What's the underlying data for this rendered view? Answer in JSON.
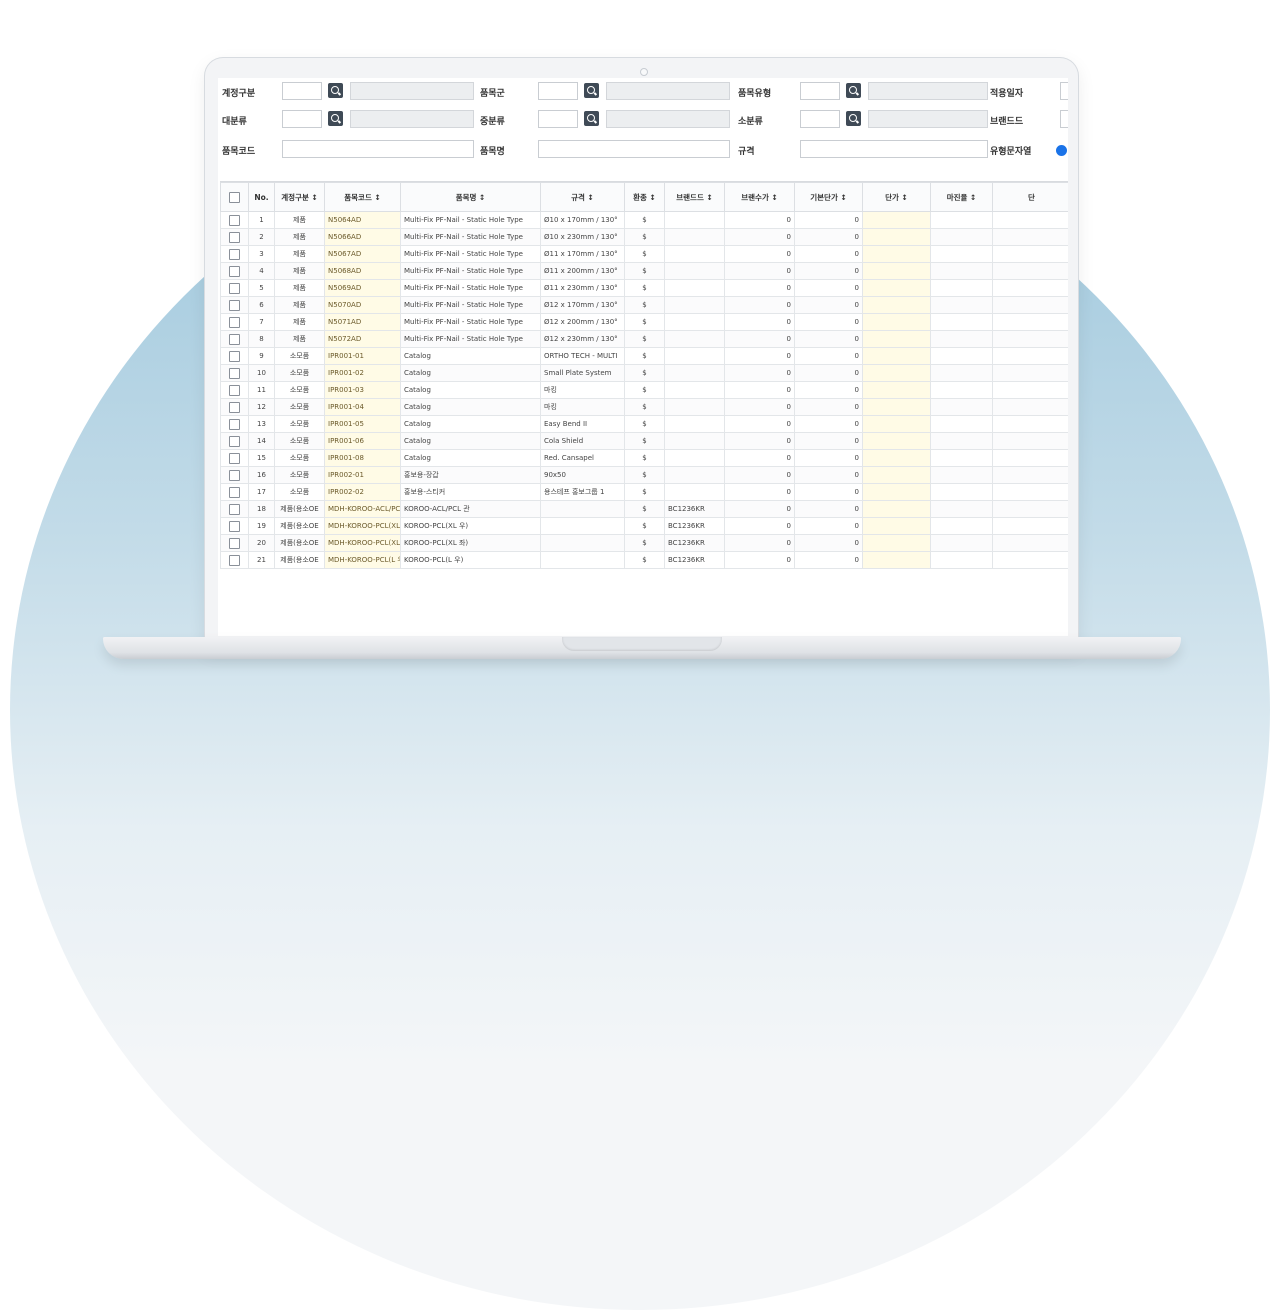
{
  "filters": [
    {
      "label": "계정구분",
      "kind": "code"
    },
    {
      "label": "품목군",
      "kind": "code"
    },
    {
      "label": "품목유형",
      "kind": "code"
    },
    {
      "label": "적용일자",
      "kind": "text"
    },
    {
      "label": "대분류",
      "kind": "code"
    },
    {
      "label": "중분류",
      "kind": "code"
    },
    {
      "label": "소분류",
      "kind": "code"
    },
    {
      "label": "브랜드드",
      "kind": "text"
    },
    {
      "label": "품목코드",
      "kind": "text"
    },
    {
      "label": "품목명",
      "kind": "text"
    },
    {
      "label": "규격",
      "kind": "text"
    },
    {
      "label": "유형문자열",
      "kind": "radio"
    }
  ],
  "grid": {
    "columns": [
      "No.",
      "계정구분 ↕",
      "품목코드 ↕",
      "품목명 ↕",
      "규격 ↕",
      "환종 ↕",
      "브랜드드 ↕",
      "브랜수가 ↕",
      "기본단가 ↕",
      "단가 ↕",
      "마진율 ↕",
      "단"
    ],
    "rows": [
      {
        "no": "1",
        "acct": "제품",
        "code": "N5064AD",
        "name": "Multi-Fix PF-Nail - Static Hole Type",
        "spec": "Ø10 x 170mm / 130°",
        "cur": "$",
        "brand": "",
        "bprice": "0",
        "base": "0"
      },
      {
        "no": "2",
        "acct": "제품",
        "code": "N5066AD",
        "name": "Multi-Fix PF-Nail - Static Hole Type",
        "spec": "Ø10 x 230mm / 130°",
        "cur": "$",
        "brand": "",
        "bprice": "0",
        "base": "0"
      },
      {
        "no": "3",
        "acct": "제품",
        "code": "N5067AD",
        "name": "Multi-Fix PF-Nail - Static Hole Type",
        "spec": "Ø11 x 170mm / 130°",
        "cur": "$",
        "brand": "",
        "bprice": "0",
        "base": "0"
      },
      {
        "no": "4",
        "acct": "제품",
        "code": "N5068AD",
        "name": "Multi-Fix PF-Nail - Static Hole Type",
        "spec": "Ø11 x 200mm / 130°",
        "cur": "$",
        "brand": "",
        "bprice": "0",
        "base": "0"
      },
      {
        "no": "5",
        "acct": "제품",
        "code": "N5069AD",
        "name": "Multi-Fix PF-Nail - Static Hole Type",
        "spec": "Ø11 x 230mm / 130°",
        "cur": "$",
        "brand": "",
        "bprice": "0",
        "base": "0"
      },
      {
        "no": "6",
        "acct": "제품",
        "code": "N5070AD",
        "name": "Multi-Fix PF-Nail - Static Hole Type",
        "spec": "Ø12 x 170mm / 130°",
        "cur": "$",
        "brand": "",
        "bprice": "0",
        "base": "0"
      },
      {
        "no": "7",
        "acct": "제품",
        "code": "N5071AD",
        "name": "Multi-Fix PF-Nail - Static Hole Type",
        "spec": "Ø12 x 200mm / 130°",
        "cur": "$",
        "brand": "",
        "bprice": "0",
        "base": "0"
      },
      {
        "no": "8",
        "acct": "제품",
        "code": "N5072AD",
        "name": "Multi-Fix PF-Nail - Static Hole Type",
        "spec": "Ø12 x 230mm / 130°",
        "cur": "$",
        "brand": "",
        "bprice": "0",
        "base": "0"
      },
      {
        "no": "9",
        "acct": "소모품",
        "code": "IPR001-01",
        "name": "Catalog",
        "spec": "ORTHO TECH - MULTI",
        "cur": "$",
        "brand": "",
        "bprice": "0",
        "base": "0"
      },
      {
        "no": "10",
        "acct": "소모품",
        "code": "IPR001-02",
        "name": "Catalog",
        "spec": "Small Plate System",
        "cur": "$",
        "brand": "",
        "bprice": "0",
        "base": "0"
      },
      {
        "no": "11",
        "acct": "소모품",
        "code": "IPR001-03",
        "name": "Catalog",
        "spec": "마킹",
        "cur": "$",
        "brand": "",
        "bprice": "0",
        "base": "0"
      },
      {
        "no": "12",
        "acct": "소모품",
        "code": "IPR001-04",
        "name": "Catalog",
        "spec": "마킹",
        "cur": "$",
        "brand": "",
        "bprice": "0",
        "base": "0"
      },
      {
        "no": "13",
        "acct": "소모품",
        "code": "IPR001-05",
        "name": "Catalog",
        "spec": "Easy Bend II",
        "cur": "$",
        "brand": "",
        "bprice": "0",
        "base": "0"
      },
      {
        "no": "14",
        "acct": "소모품",
        "code": "IPR001-06",
        "name": "Catalog",
        "spec": "Cola Shield",
        "cur": "$",
        "brand": "",
        "bprice": "0",
        "base": "0"
      },
      {
        "no": "15",
        "acct": "소모품",
        "code": "IPR001-08",
        "name": "Catalog",
        "spec": "Red. Cansapel",
        "cur": "$",
        "brand": "",
        "bprice": "0",
        "base": "0"
      },
      {
        "no": "16",
        "acct": "소모품",
        "code": "IPR002-01",
        "name": "홍보용-장갑",
        "spec": "90x50",
        "cur": "$",
        "brand": "",
        "bprice": "0",
        "base": "0"
      },
      {
        "no": "17",
        "acct": "소모품",
        "code": "IPR002-02",
        "name": "홍보용-스티커",
        "spec": "용스테프 홍보그룹 1",
        "cur": "$",
        "brand": "",
        "bprice": "0",
        "base": "0"
      },
      {
        "no": "18",
        "acct": "제품(용소OE",
        "code": "MDH-KOROO-ACL/PCL",
        "name": "KOROO-ACL/PCL 관",
        "spec": "",
        "cur": "$",
        "brand": "BC1236KR",
        "bprice": "0",
        "base": "0"
      },
      {
        "no": "19",
        "acct": "제품(용소OE",
        "code": "MDH-KOROO-PCL(XL",
        "name": "KOROO-PCL(XL 우)",
        "spec": "",
        "cur": "$",
        "brand": "BC1236KR",
        "bprice": "0",
        "base": "0"
      },
      {
        "no": "20",
        "acct": "제품(용소OE",
        "code": "MDH-KOROO-PCL(XL",
        "name": "KOROO-PCL(XL 좌)",
        "spec": "",
        "cur": "$",
        "brand": "BC1236KR",
        "bprice": "0",
        "base": "0"
      },
      {
        "no": "21",
        "acct": "제품(용소OE",
        "code": "MDH-KOROO-PCL(L 우)",
        "name": "KOROO-PCL(L 우)",
        "spec": "",
        "cur": "$",
        "brand": "BC1236KR",
        "bprice": "0",
        "base": "0"
      }
    ]
  }
}
